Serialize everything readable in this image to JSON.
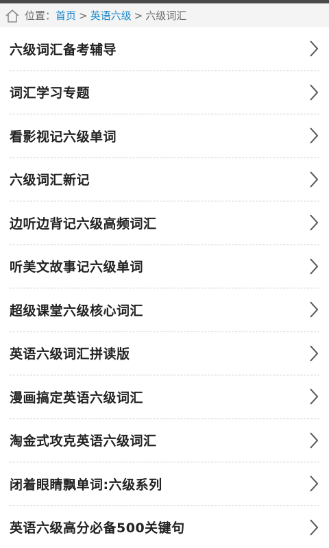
{
  "breadcrumb": {
    "prefix": "位置：",
    "home": "首页",
    "category": "英语六级",
    "current": "六级词汇",
    "separator": ">",
    "home_icon": "house-outline-icon"
  },
  "items": [
    {
      "label": "六级词汇备考辅导"
    },
    {
      "label": "词汇学习专题"
    },
    {
      "label": "看影视记六级单词"
    },
    {
      "label": "六级词汇新记"
    },
    {
      "label": "边听边背记六级高频词汇"
    },
    {
      "label": "听美文故事记六级单词"
    },
    {
      "label": "超级课堂六级核心词汇"
    },
    {
      "label": "英语六级词汇拼读版"
    },
    {
      "label": "漫画搞定英语六级词汇"
    },
    {
      "label": "淘金式攻克英语六级词汇"
    },
    {
      "label": "闭着眼睛飘单词:六级系列"
    },
    {
      "label": "英语六级高分必备500关键句"
    }
  ],
  "colors": {
    "link": "#1a87c9",
    "text": "#222222",
    "chevron": "#555555"
  }
}
